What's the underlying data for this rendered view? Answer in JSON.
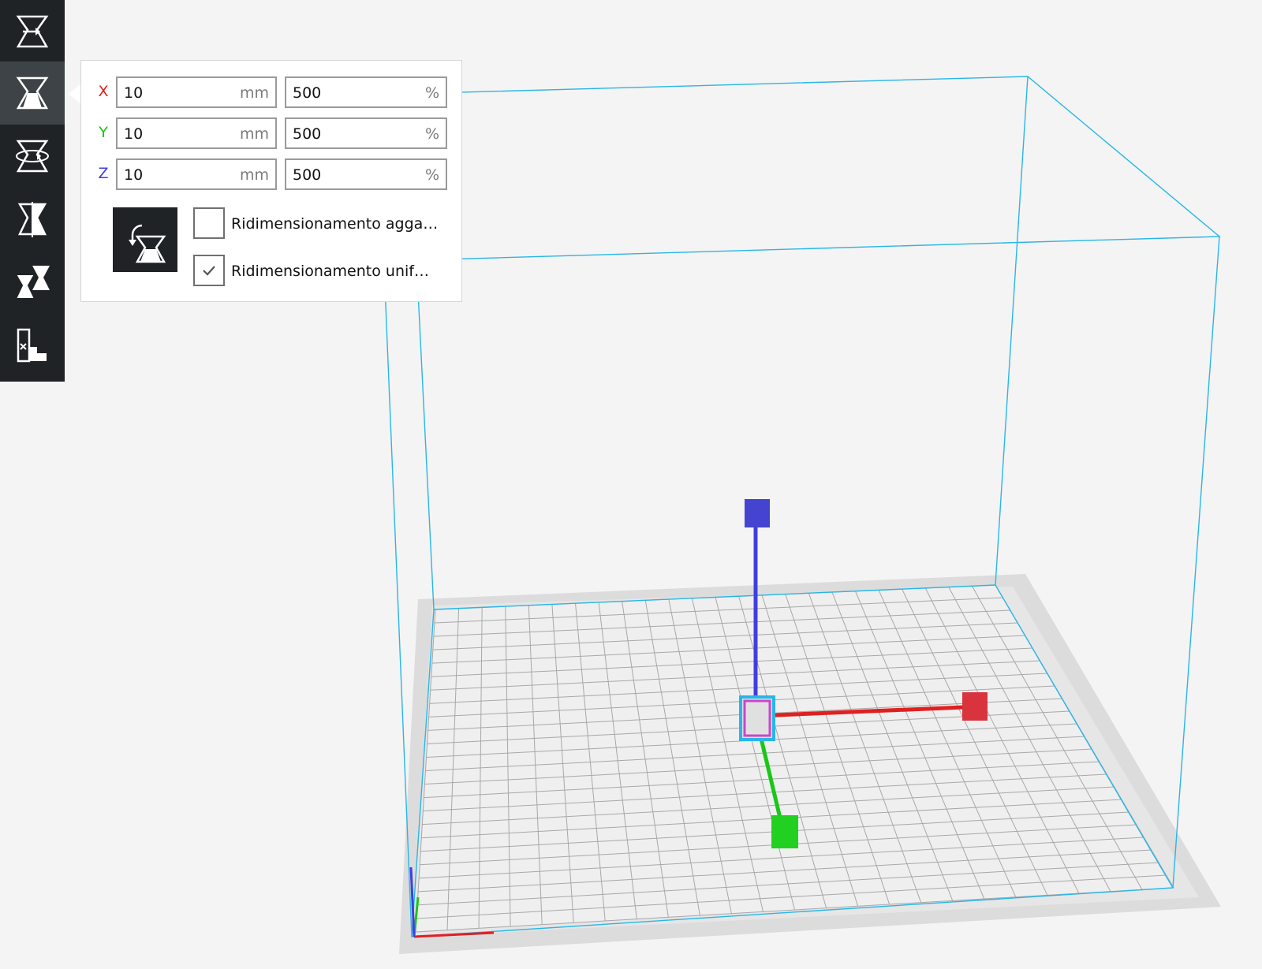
{
  "scale_panel": {
    "x": {
      "axis": "X",
      "mm_value": "10",
      "mm_unit": "mm",
      "percent_value": "500",
      "percent_unit": "%"
    },
    "y": {
      "axis": "Y",
      "mm_value": "10",
      "mm_unit": "mm",
      "percent_value": "500",
      "percent_unit": "%"
    },
    "z": {
      "axis": "Z",
      "mm_value": "10",
      "mm_unit": "mm",
      "percent_value": "500",
      "percent_unit": "%"
    },
    "snap_scaling": {
      "label": "Ridimensionamento agga…",
      "checked": false
    },
    "uniform_scaling": {
      "label": "Ridimensionamento unif…",
      "checked": true
    },
    "reset_icon": "reset-scale-icon"
  },
  "toolbar": {
    "tools": [
      "move-icon",
      "scale-icon",
      "rotate-icon",
      "mirror-icon",
      "per-model-settings-icon",
      "support-blocker-icon"
    ],
    "active_tool": "scale-icon"
  },
  "colors": {
    "axis_x": "#e02020",
    "axis_y": "#19c719",
    "axis_z": "#3f3fe0",
    "build_volume": "#29b6e6",
    "toolbar_bg": "#1f2326",
    "toolbar_active": "#3d4346"
  }
}
